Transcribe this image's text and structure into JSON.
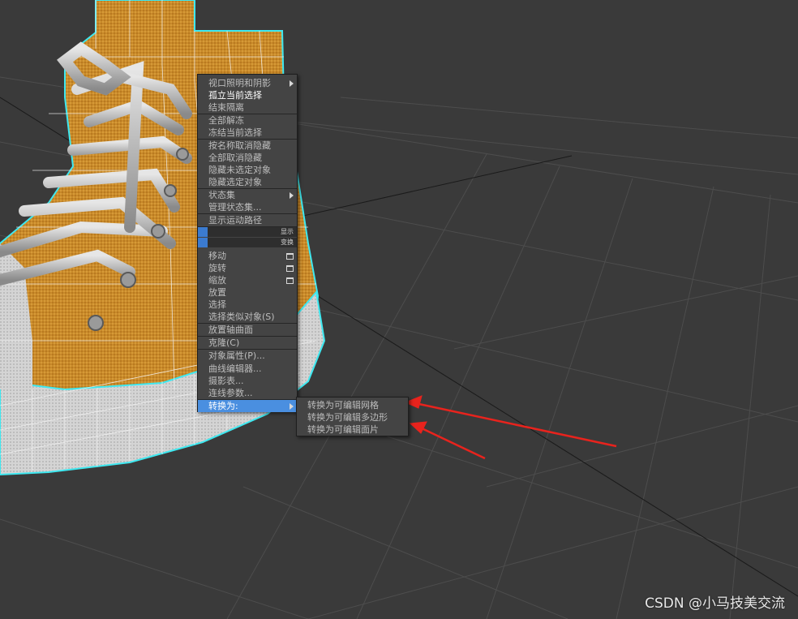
{
  "quad_menu": {
    "items": [
      {
        "label": "视口照明和阴影",
        "submenu": true
      },
      {
        "label": "孤立当前选择",
        "bright": true
      },
      {
        "label": "结束隔离"
      },
      {
        "label": "全部解冻"
      },
      {
        "label": "冻结当前选择"
      },
      {
        "label": "按名称取消隐藏"
      },
      {
        "label": "全部取消隐藏"
      },
      {
        "label": "隐藏未选定对象"
      },
      {
        "label": "隐藏选定对象"
      },
      {
        "label": "状态集",
        "submenu": true
      },
      {
        "label": "管理状态集..."
      },
      {
        "label": "显示运动路径"
      },
      {
        "label": "移动",
        "options": true
      },
      {
        "label": "旋转",
        "options": true
      },
      {
        "label": "缩放",
        "options": true
      },
      {
        "label": "放置"
      },
      {
        "label": "选择"
      },
      {
        "label": "选择类似对象(S)"
      },
      {
        "label": "放置轴曲面"
      },
      {
        "label": "克隆(C)"
      },
      {
        "label": "对象属性(P)..."
      },
      {
        "label": "曲线编辑器..."
      },
      {
        "label": "摄影表..."
      },
      {
        "label": "连线参数..."
      },
      {
        "label": "转换为:",
        "submenu": true,
        "highlighted": true
      }
    ],
    "quad_labels": [
      "显示",
      "变换"
    ]
  },
  "submenu": {
    "items": [
      "转换为可编辑网格",
      "转换为可编辑多边形",
      "转换为可编辑面片"
    ]
  },
  "watermark": "CSDN @小马技美交流",
  "colors": {
    "viewport_bg": "#3a3a3a",
    "grid_line": "#4d4d4d",
    "menu_bg": "#444444",
    "highlight": "#4a8fe0",
    "annotation_arrow": "#e8231d",
    "selection_outline": "#3ee8f0",
    "shoe_canvas": "#c98a2a",
    "shoe_rubber": "#d8d8d8"
  }
}
